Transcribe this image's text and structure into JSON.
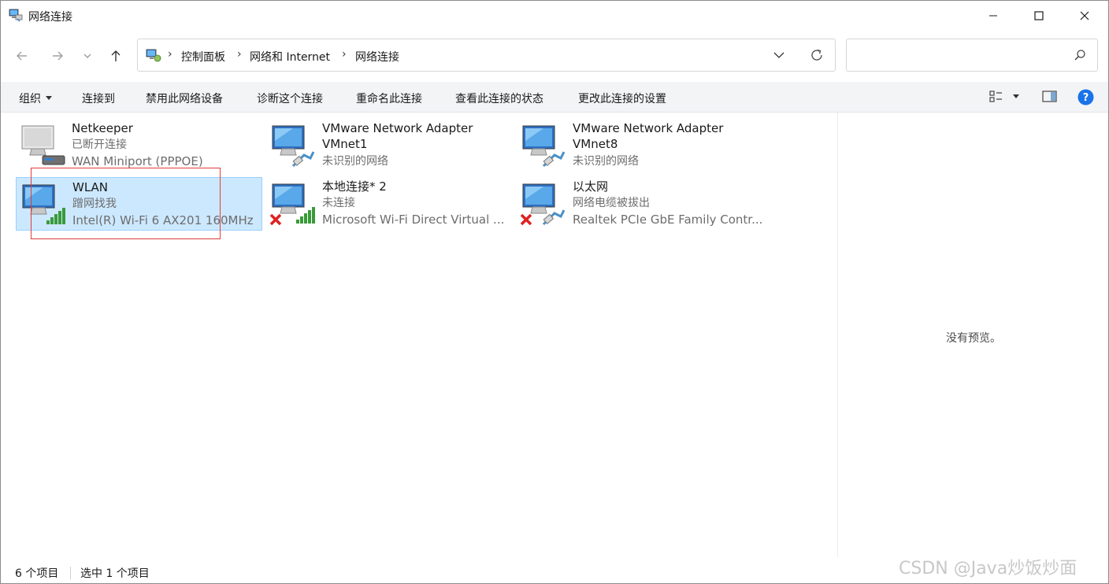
{
  "window": {
    "title": "网络连接"
  },
  "breadcrumb": [
    "控制面板",
    "网络和 Internet",
    "网络连接"
  ],
  "search": {
    "placeholder": ""
  },
  "commands": {
    "organize": "组织",
    "connect_to": "连接到",
    "disable": "禁用此网络设备",
    "diagnose": "诊断这个连接",
    "rename": "重命名此连接",
    "view_status": "查看此连接的状态",
    "change_settings": "更改此连接的设置"
  },
  "connections": [
    {
      "name": "Netkeeper",
      "status": "已断开连接",
      "device": "WAN Miniport (PPPOE)",
      "icon": "dialup-network-icon"
    },
    {
      "name": "VMware Network Adapter",
      "name2": "VMnet1",
      "status": "未识别的网络",
      "icon": "ethernet-network-icon"
    },
    {
      "name": "VMware Network Adapter",
      "name2": "VMnet8",
      "status": "未识别的网络",
      "icon": "ethernet-network-icon"
    },
    {
      "name": "WLAN",
      "status": "蹭网找我",
      "device": "Intel(R) Wi-Fi 6 AX201 160MHz",
      "icon": "wifi-network-icon",
      "selected": true
    },
    {
      "name": "本地连接* 2",
      "status": "未连接",
      "device": "Microsoft Wi-Fi Direct Virtual ...",
      "icon": "wifi-network-disconnected-icon"
    },
    {
      "name": "以太网",
      "status": "网络电缆被拔出",
      "device": "Realtek PCIe GbE Family Contr...",
      "icon": "ethernet-network-disconnected-icon"
    }
  ],
  "preview": {
    "text": "没有预览。"
  },
  "status": {
    "count": "6 个项目",
    "selected": "选中 1 个项目"
  },
  "watermark": "CSDN @Java炒饭炒面",
  "colors": {
    "selection": "#cce8ff",
    "selection_border": "#99d1ff",
    "highlight_box": "#e33b3b",
    "help": "#1a73e8"
  }
}
